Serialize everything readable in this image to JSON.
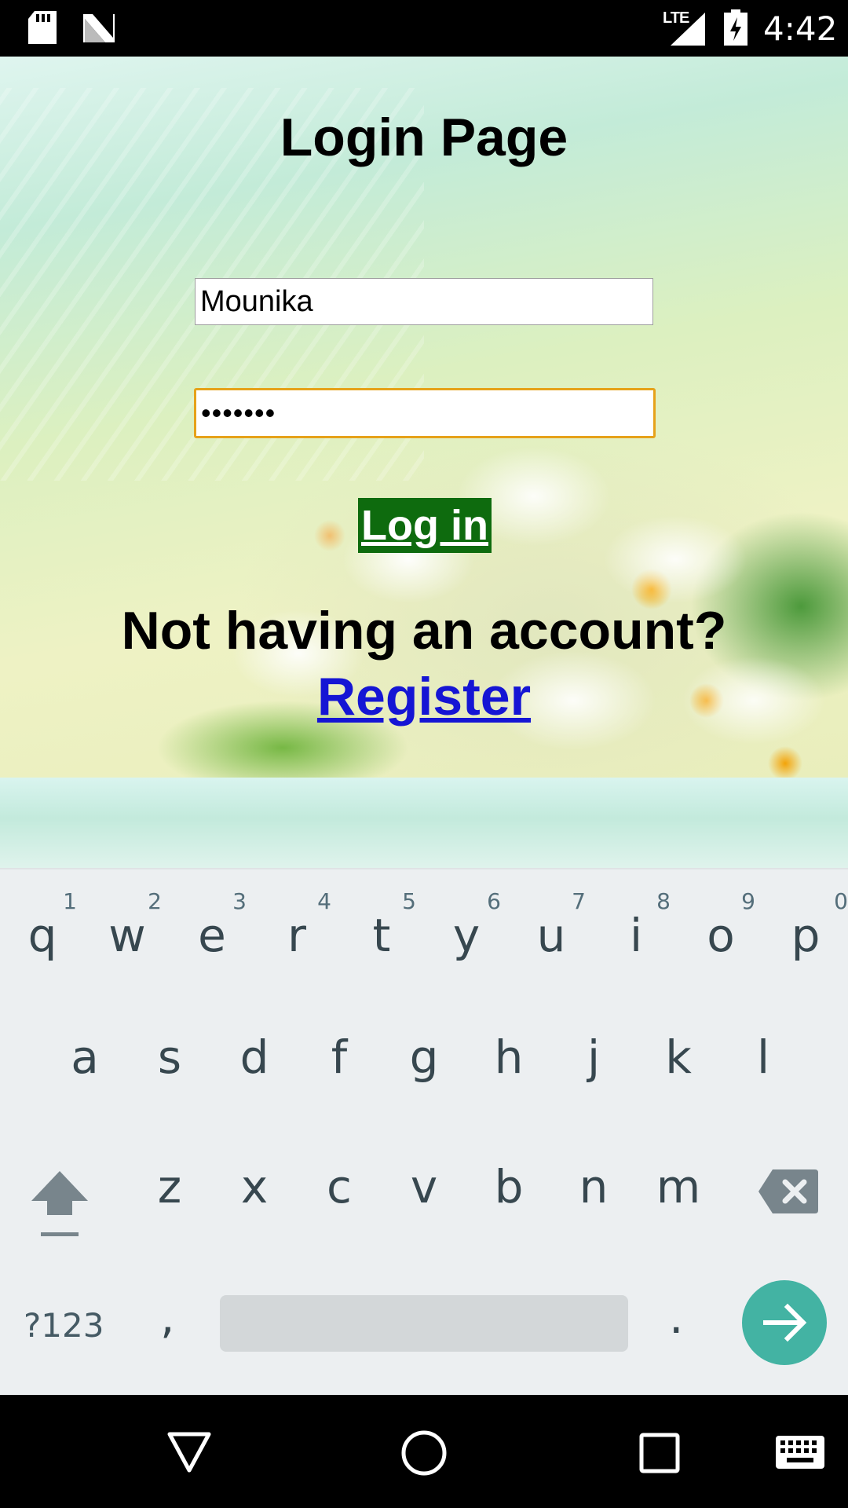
{
  "status_bar": {
    "time": "4:42",
    "network": "LTE",
    "icons": [
      "sd-card-icon",
      "n-notification-icon",
      "signal-icon",
      "battery-charging-icon"
    ]
  },
  "page": {
    "title": "Login Page",
    "username_value": "Mounika",
    "password_value": "•••••••",
    "login_label": "Log in",
    "no_account_text": "Not having an account?",
    "register_label": "Register"
  },
  "keyboard": {
    "row1": [
      {
        "key": "q",
        "hint": "1"
      },
      {
        "key": "w",
        "hint": "2"
      },
      {
        "key": "e",
        "hint": "3"
      },
      {
        "key": "r",
        "hint": "4"
      },
      {
        "key": "t",
        "hint": "5"
      },
      {
        "key": "y",
        "hint": "6"
      },
      {
        "key": "u",
        "hint": "7"
      },
      {
        "key": "i",
        "hint": "8"
      },
      {
        "key": "o",
        "hint": "9"
      },
      {
        "key": "p",
        "hint": "0"
      }
    ],
    "row2": [
      "a",
      "s",
      "d",
      "f",
      "g",
      "h",
      "j",
      "k",
      "l"
    ],
    "row3": [
      "z",
      "x",
      "c",
      "v",
      "b",
      "n",
      "m"
    ],
    "symbols_label": "?123",
    "comma": ",",
    "period": ".",
    "icons": [
      "shift-icon",
      "backspace-icon",
      "enter-arrow-icon"
    ]
  },
  "nav_bar": {
    "icons": [
      "back-icon",
      "home-icon",
      "recents-icon",
      "keyboard-icon"
    ]
  },
  "colors": {
    "login_button_bg": "#0e6b0e",
    "register_link": "#1515d4",
    "focused_border": "#e6a21a",
    "enter_key": "#43b3a3"
  }
}
